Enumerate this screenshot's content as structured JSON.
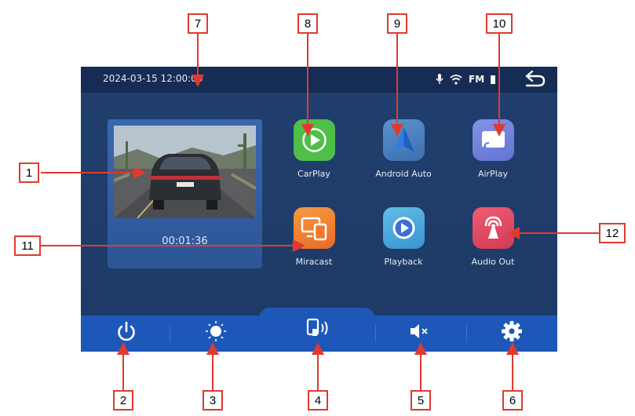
{
  "status_bar": {
    "datetime": "2024-03-15 12:00:00",
    "radio": "FM",
    "icons": [
      "microphone-icon",
      "wifi-icon",
      "battery-icon",
      "back-icon"
    ]
  },
  "recording": {
    "elapsed": "00:01:36"
  },
  "apps": [
    {
      "label": "CarPlay",
      "icon": "carplay-icon",
      "color": "#4fbf4a"
    },
    {
      "label": "Android Auto",
      "icon": "android-auto-icon",
      "color": "#4b86c6"
    },
    {
      "label": "AirPlay",
      "icon": "airplay-icon",
      "color": "#6f7fd8"
    },
    {
      "label": "Miracast",
      "icon": "miracast-icon",
      "color": "#f07a2c"
    },
    {
      "label": "Playback",
      "icon": "playback-icon",
      "color": "#46a6d9"
    },
    {
      "label": "Audio Out",
      "icon": "audio-out-icon",
      "color": "#e04a64"
    }
  ],
  "bottom_bar": {
    "icons": [
      "power-icon",
      "brightness-icon",
      "screen-cast-icon",
      "mute-icon",
      "settings-icon"
    ]
  },
  "callouts": [
    "1",
    "2",
    "3",
    "4",
    "5",
    "6",
    "7",
    "8",
    "9",
    "10",
    "11",
    "12"
  ],
  "colors": {
    "screen_bg": "#1f3c69",
    "bottom_bar": "#1d58b8",
    "callout_border": "#e03a2f"
  }
}
